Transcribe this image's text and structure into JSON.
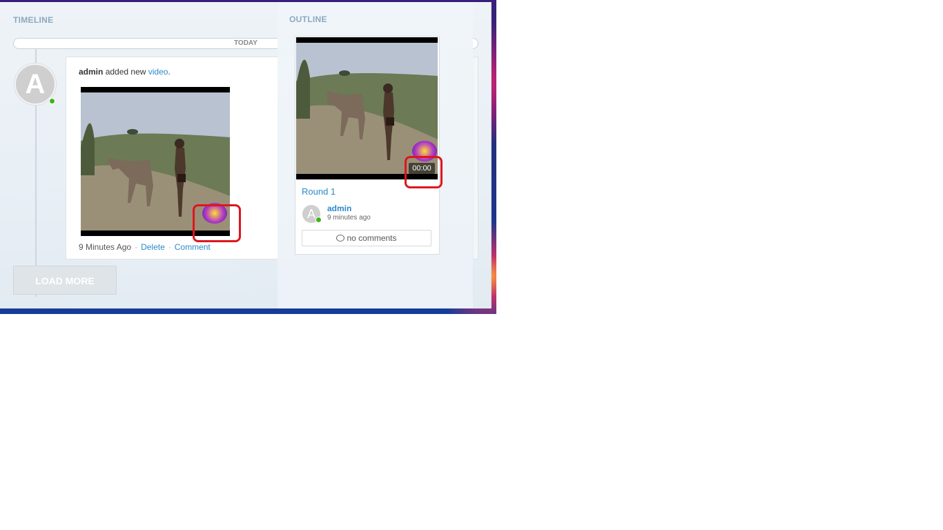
{
  "timeline": {
    "title": "TIMELINE",
    "today_label": "TODAY",
    "avatar_letter": "A",
    "post": {
      "author": "admin",
      "action_text": "added new",
      "object_link": "video",
      "suffix": ".",
      "time_ago": "9 Minutes Ago",
      "delete_label": "Delete",
      "comment_label": "Comment"
    },
    "load_more_label": "LOAD MORE"
  },
  "outline": {
    "title": "OUTLINE",
    "card": {
      "video_time": "00:00",
      "title": "Round 1",
      "avatar_letter": "A",
      "author": "admin",
      "time_ago": "9 minutes ago",
      "comments_label": "no comments"
    }
  },
  "colors": {
    "link": "#2a8ac9",
    "online": "#3fb618",
    "highlight": "#e0141e"
  }
}
